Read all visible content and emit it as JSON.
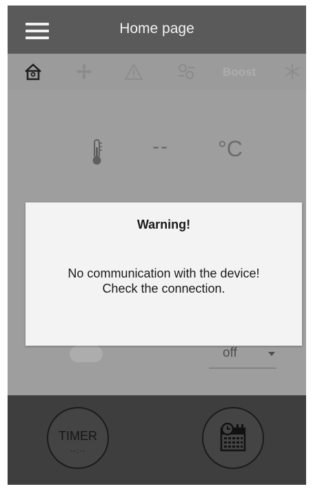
{
  "header": {
    "title": "Home page"
  },
  "toolbar": {
    "items": [
      "home-icon",
      "fan-mode-icon",
      "alarm-icon",
      "fan-speed-icon",
      "Boost",
      "snowflake-icon"
    ],
    "boost_label": "Boost"
  },
  "status": {
    "temperature_value": "--",
    "temperature_unit": "°C"
  },
  "controls": {
    "mode_value": "off"
  },
  "footer": {
    "timer_label": "TIMER",
    "timer_value": "--:--"
  },
  "dialog": {
    "title": "Warning!",
    "message_line1": "No communication with the device!",
    "message_line2": "Check the connection."
  },
  "colors": {
    "header_bg": "#5a5a5a",
    "overlay_bg": "#9e9e9e",
    "footer_bg": "#3e3e3e",
    "dialog_bg": "#f3f3f3"
  }
}
